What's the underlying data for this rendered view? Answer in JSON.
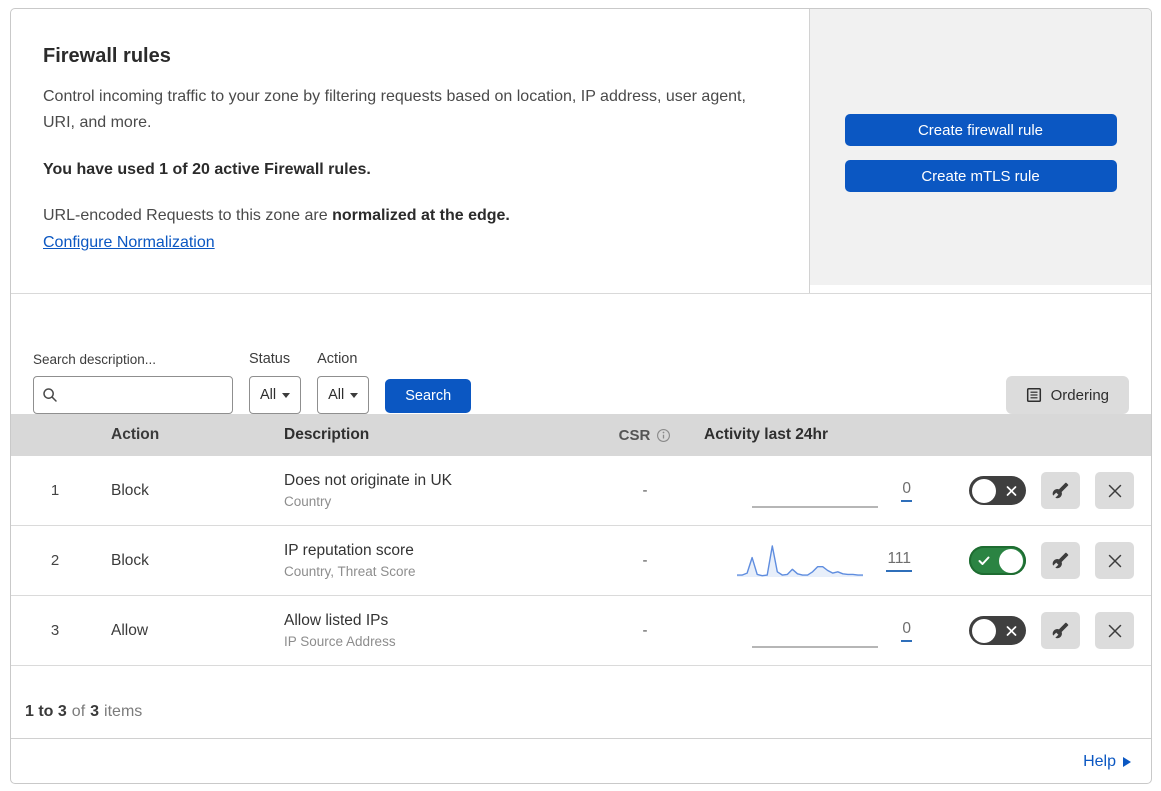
{
  "header": {
    "title": "Firewall rules",
    "description": "Control incoming traffic to your zone by filtering requests based on location, IP address, user agent, URI, and more.",
    "usage_note": "You have used 1 of 20 active Firewall rules.",
    "normalization_text": "URL-encoded Requests to this zone are",
    "normalization_bold": "normalized at the edge.",
    "normalization_link": "Configure Normalization",
    "create_firewall_rule_label": "Create firewall rule",
    "create_mtls_rule_label": "Create mTLS rule"
  },
  "filters": {
    "search_label": "Search description...",
    "status_label": "Status",
    "status_value": "All",
    "action_label": "Action",
    "action_value": "All",
    "search_button_label": "Search",
    "ordering_button_label": "Ordering"
  },
  "table": {
    "headers": {
      "action": "Action",
      "description": "Description",
      "csr": "CSR",
      "activity": "Activity last 24hr"
    },
    "rows": [
      {
        "priority": "1",
        "action": "Block",
        "description": "Does not originate in UK",
        "match_fields": "Country",
        "csr": "-",
        "activity_count": "0",
        "enabled": false,
        "activity_sparkline": [
          0,
          0,
          0,
          0,
          0,
          0,
          0,
          0,
          0,
          0,
          0,
          0,
          0,
          0,
          0,
          0,
          0,
          0,
          0,
          0,
          0,
          0,
          0,
          0,
          0,
          0
        ]
      },
      {
        "priority": "2",
        "action": "Block",
        "description": "IP reputation score",
        "match_fields": "Country, Threat Score",
        "csr": "-",
        "activity_count": "111",
        "enabled": true,
        "activity_sparkline": [
          3,
          3,
          6,
          30,
          4,
          2,
          3,
          48,
          8,
          3,
          4,
          12,
          5,
          3,
          3,
          8,
          16,
          16,
          10,
          6,
          8,
          5,
          4,
          4,
          3,
          3
        ]
      },
      {
        "priority": "3",
        "action": "Allow",
        "description": "Allow listed IPs",
        "match_fields": "IP Source Address",
        "csr": "-",
        "activity_count": "0",
        "enabled": false,
        "activity_sparkline": [
          0,
          0,
          0,
          0,
          0,
          0,
          0,
          0,
          0,
          0,
          0,
          0,
          0,
          0,
          0,
          0,
          0,
          0,
          0,
          0,
          0,
          0,
          0,
          0,
          0,
          0
        ]
      }
    ]
  },
  "summary": {
    "range": "1 to 3",
    "of": "of",
    "total": "3",
    "items": "items"
  },
  "footer": {
    "help_label": "Help"
  },
  "colors": {
    "accent_blue": "#0b57c2",
    "toggle_on_green": "#2b8443",
    "toggle_off_gray": "#3f3f3f",
    "sparkline_blue": "#5f8ddf",
    "panel_gray": "#f1f1f1",
    "table_header_gray": "#d8d8d8"
  }
}
